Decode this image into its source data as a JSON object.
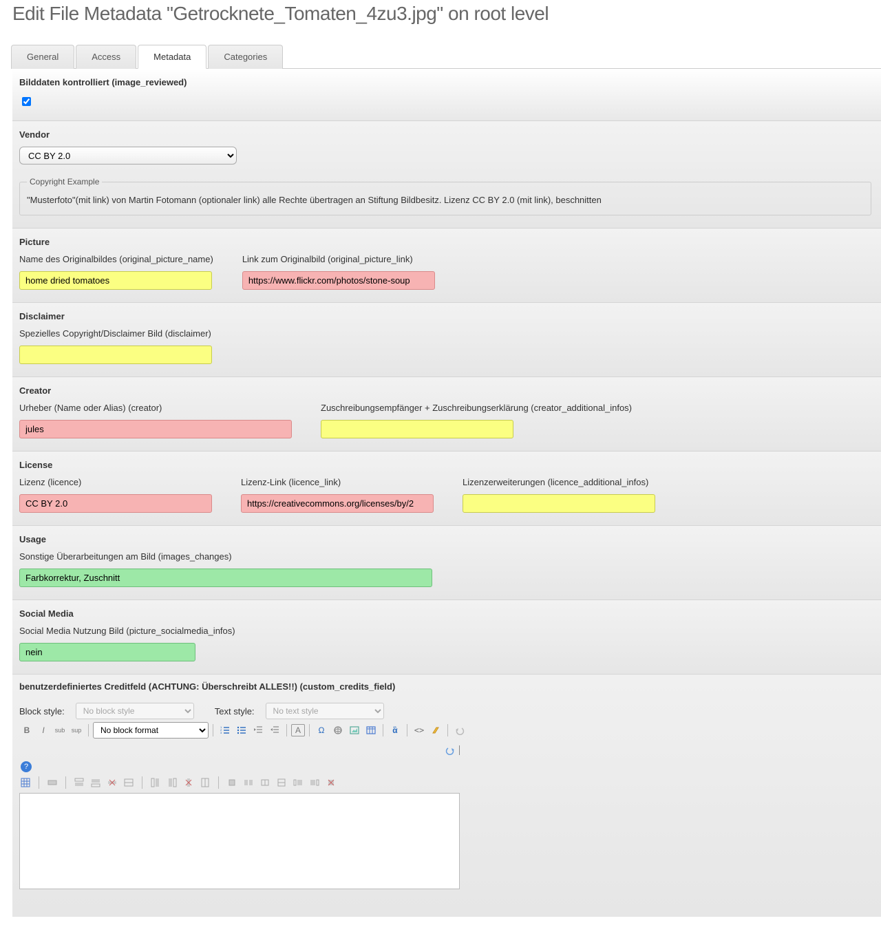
{
  "page_title": "Edit File Metadata \"Getrocknete_Tomaten_4zu3.jpg\" on root level",
  "tabs": {
    "general": "General",
    "access": "Access",
    "metadata": "Metadata",
    "categories": "Categories"
  },
  "sections": {
    "image_reviewed": {
      "title": "Bilddaten kontrolliert (image_reviewed)",
      "checked": true
    },
    "vendor": {
      "title": "Vendor",
      "selected": "CC BY 2.0",
      "example_legend": "Copyright Example",
      "example_text": "\"Musterfoto\"(mit link) von Martin Fotomann (optionaler link) alle Rechte übertragen an Stiftung Bildbesitz. Lizenz CC BY 2.0 (mit link), beschnitten"
    },
    "picture": {
      "title": "Picture",
      "name_label": "Name des Originalbildes (original_picture_name)",
      "name_value": "home dried tomatoes",
      "link_label": "Link zum Originalbild (original_picture_link)",
      "link_value": "https://www.flickr.com/photos/stone-soup"
    },
    "disclaimer": {
      "title": "Disclaimer",
      "label": "Spezielles Copyright/Disclaimer Bild (disclaimer)",
      "value": ""
    },
    "creator": {
      "title": "Creator",
      "creator_label": "Urheber (Name oder Alias) (creator)",
      "creator_value": "jules",
      "add_label": "Zuschreibungsempfänger + Zuschreibungserklärung (creator_additional_infos)",
      "add_value": ""
    },
    "license": {
      "title": "License",
      "licence_label": "Lizenz (licence)",
      "licence_value": "CC BY 2.0",
      "link_label": "Lizenz-Link (licence_link)",
      "link_value": "https://creativecommons.org/licenses/by/2",
      "add_label": "Lizenzerweiterungen (licence_additional_infos)",
      "add_value": ""
    },
    "usage": {
      "title": "Usage",
      "label": "Sonstige Überarbeitungen am Bild (images_changes)",
      "value": "Farbkorrektur, Zuschnitt"
    },
    "social": {
      "title": "Social Media",
      "label": "Social Media Nutzung Bild (picture_socialmedia_infos)",
      "value": "nein"
    },
    "credits": {
      "title": "benutzerdefiniertes Creditfeld (ACHTUNG: Überschreibt ALLES!!) (custom_credits_field)"
    }
  },
  "rte": {
    "block_style_label": "Block style:",
    "block_style_placeholder": "No block style",
    "text_style_label": "Text style:",
    "text_style_placeholder": "No text style",
    "block_format_value": "No block format"
  }
}
